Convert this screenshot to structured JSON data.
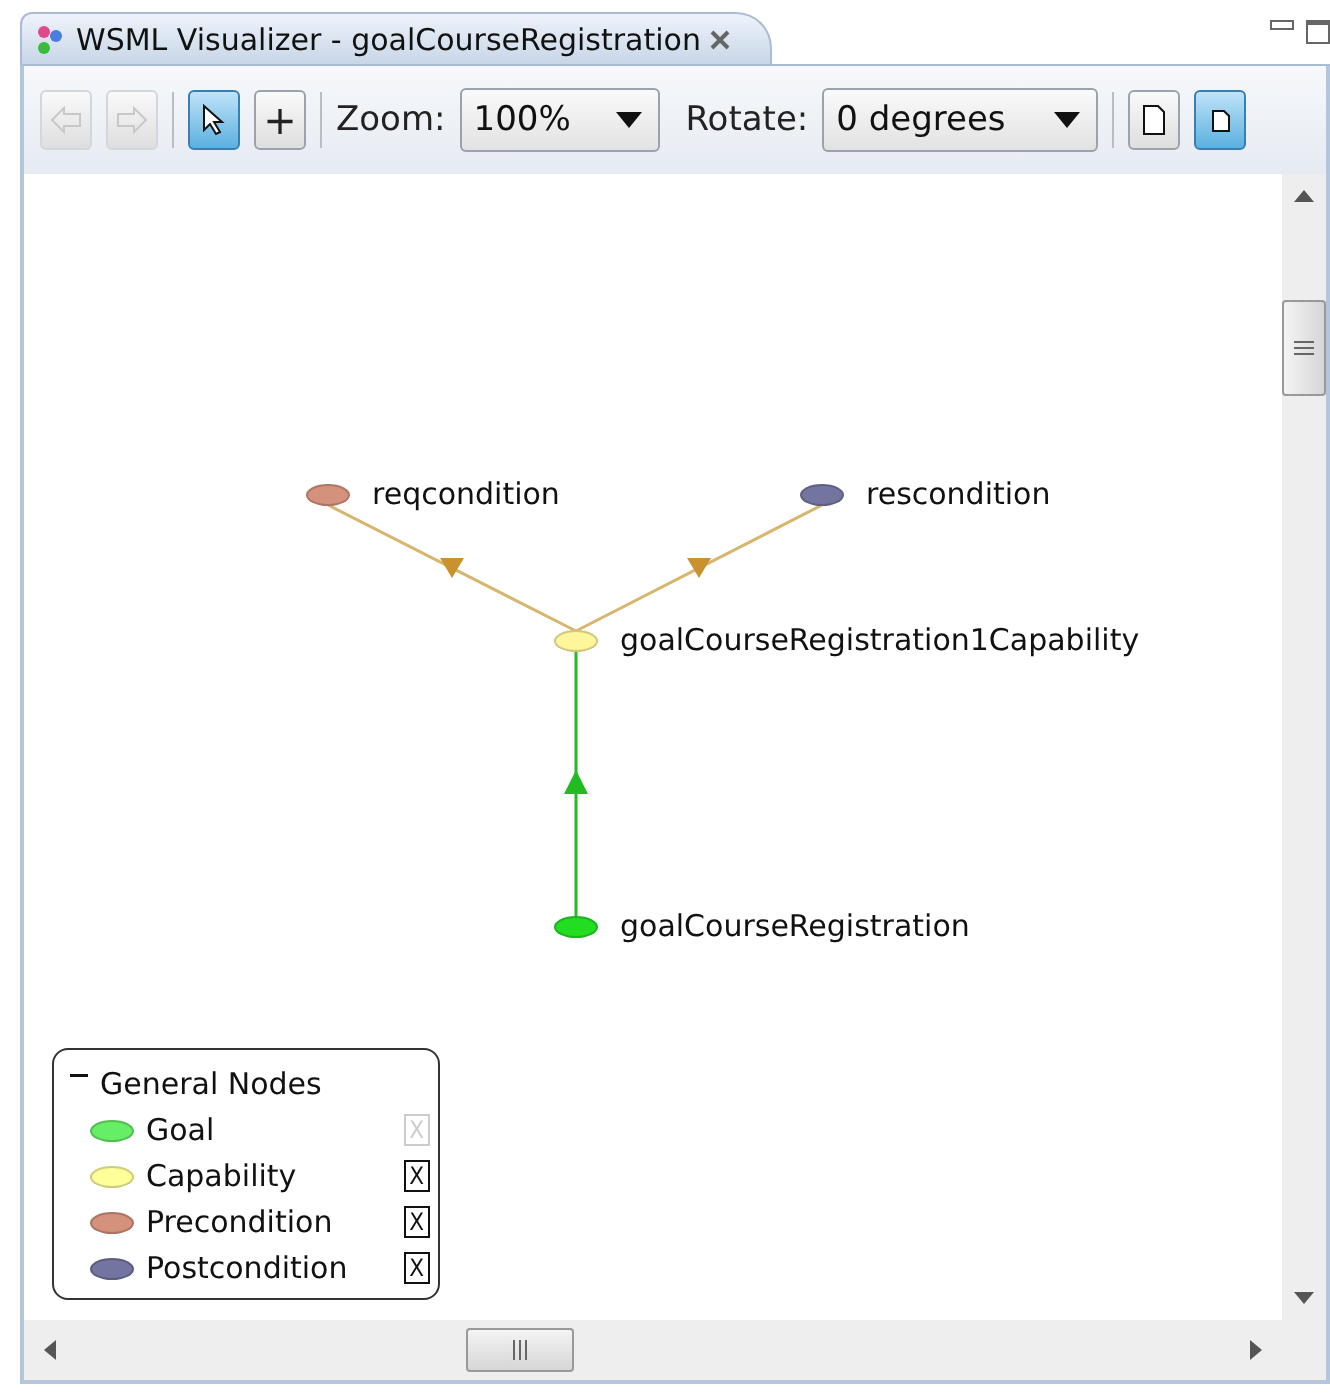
{
  "window": {
    "title": "WSML Visualizer - goalCourseRegistration"
  },
  "toolbar": {
    "nav": [
      {
        "kind": "back",
        "disabled": true
      },
      {
        "kind": "forward",
        "disabled": true
      }
    ],
    "tools": [
      {
        "kind": "select",
        "selected": true
      },
      {
        "kind": "add",
        "label": "+",
        "selected": false
      }
    ],
    "zoom": {
      "label": "Zoom:",
      "value": "100%"
    },
    "rotate": {
      "label": "Rotate:",
      "value": "0 degrees"
    },
    "views": [
      {
        "kind": "page",
        "selected": false
      },
      {
        "kind": "small-page",
        "selected": true
      }
    ]
  },
  "graph": {
    "nodes": [
      {
        "label": "reqcondition",
        "color": "#d4917c"
      },
      {
        "label": "rescondition",
        "color": "#7474a0"
      },
      {
        "label": "goalCourseRegistration1Capability",
        "color": "#fff59a"
      },
      {
        "label": "goalCourseRegistration",
        "color": "#22dd22"
      }
    ],
    "edges": [
      {
        "color": "#d8b66e"
      },
      {
        "color": "#d8b66e"
      },
      {
        "color": "#22bb22"
      }
    ]
  },
  "legend": {
    "title": "General Nodes",
    "items": [
      {
        "label": "Goal",
        "color": "#66ee66",
        "box": "X",
        "disabled": true
      },
      {
        "label": "Capability",
        "color": "#ffff99",
        "box": "X",
        "disabled": false
      },
      {
        "label": "Precondition",
        "color": "#d4917c",
        "box": "X",
        "disabled": false
      },
      {
        "label": "Postcondition",
        "color": "#7474a0",
        "box": "X",
        "disabled": false
      }
    ]
  }
}
